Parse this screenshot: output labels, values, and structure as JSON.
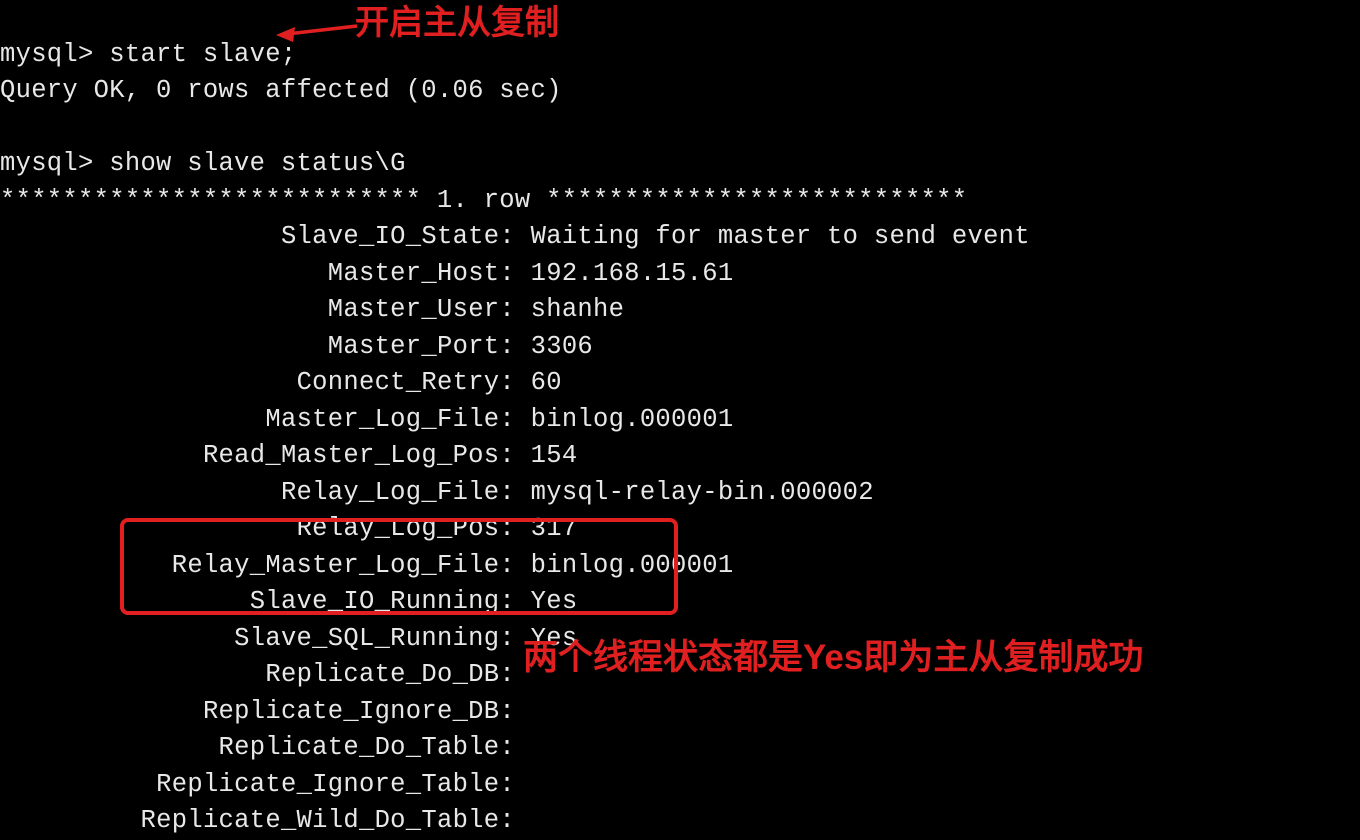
{
  "prompt": "mysql>",
  "cmd_start_slave": "start slave;",
  "result_start_slave": "Query OK, 0 rows affected (0.06 sec)",
  "cmd_status": "show slave status\\G",
  "row_header_left": "***************************",
  "row_header_mid": " 1. row ",
  "row_header_right": "***************************",
  "status": {
    "slave_io_state": {
      "k": "Slave_IO_State:",
      "v": "Waiting for master to send event"
    },
    "master_host": {
      "k": "Master_Host:",
      "v": "192.168.15.61"
    },
    "master_user": {
      "k": "Master_User:",
      "v": "shanhe"
    },
    "master_port": {
      "k": "Master_Port:",
      "v": "3306"
    },
    "connect_retry": {
      "k": "Connect_Retry:",
      "v": "60"
    },
    "master_log_file": {
      "k": "Master_Log_File:",
      "v": "binlog.000001"
    },
    "read_master_log_pos": {
      "k": "Read_Master_Log_Pos:",
      "v": "154"
    },
    "relay_log_file": {
      "k": "Relay_Log_File:",
      "v": "mysql-relay-bin.000002"
    },
    "relay_log_pos": {
      "k": "Relay_Log_Pos:",
      "v": "317"
    },
    "relay_master_log_file": {
      "k": "Relay_Master_Log_File:",
      "v": "binlog.000001"
    },
    "slave_io_running": {
      "k": "Slave_IO_Running:",
      "v": "Yes"
    },
    "slave_sql_running": {
      "k": "Slave_SQL_Running:",
      "v": "Yes"
    },
    "replicate_do_db": {
      "k": "Replicate_Do_DB:",
      "v": ""
    },
    "replicate_ignore_db": {
      "k": "Replicate_Ignore_DB:",
      "v": ""
    },
    "replicate_do_table": {
      "k": "Replicate_Do_Table:",
      "v": ""
    },
    "replicate_ignore_table": {
      "k": "Replicate_Ignore_Table:",
      "v": ""
    },
    "replicate_wild_do_table": {
      "k": "Replicate_Wild_Do_Table:",
      "v": ""
    }
  },
  "annotations": {
    "top": "开启主从复制",
    "bottom": "两个线程状态都是Yes即为主从复制成功"
  },
  "colors": {
    "annotation_red": "#e02020"
  }
}
